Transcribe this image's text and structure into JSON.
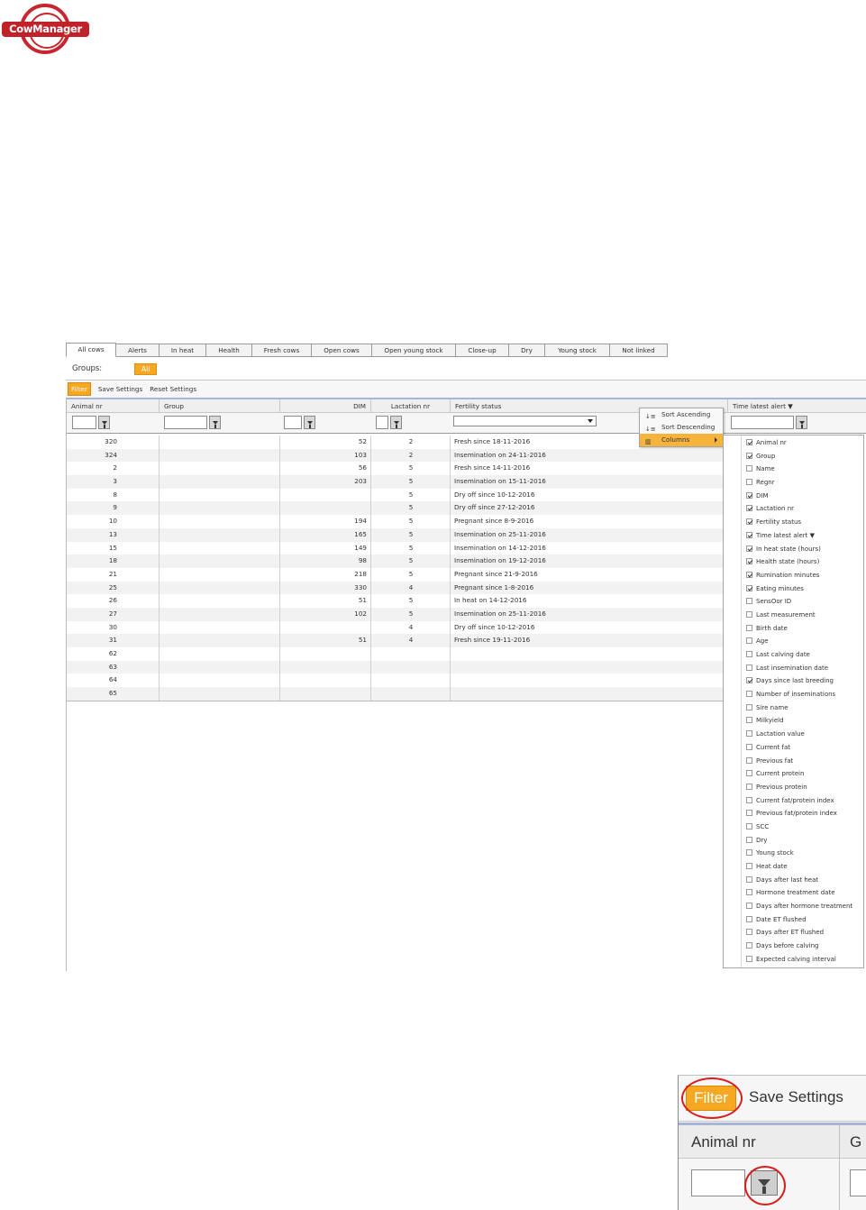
{
  "logo": {
    "text": "CowManager"
  },
  "tabs": [
    {
      "label": "All cows",
      "active": true
    },
    {
      "label": "Alerts"
    },
    {
      "label": "In heat"
    },
    {
      "label": "Health"
    },
    {
      "label": "Fresh cows"
    },
    {
      "label": "Open cows"
    },
    {
      "label": "Open young stock"
    },
    {
      "label": "Close-up"
    },
    {
      "label": "Dry"
    },
    {
      "label": "Young stock"
    },
    {
      "label": "Not linked"
    }
  ],
  "groups": {
    "label": "Groups:",
    "all_button": "All"
  },
  "toolbar": {
    "filter": "Filter",
    "save": "Save Settings",
    "reset": "Reset Settings"
  },
  "columns": {
    "animal_nr": "Animal nr",
    "group": "Group",
    "dim": "DIM",
    "lactation_nr": "Lactation nr",
    "fertility_status": "Fertility status",
    "time_latest_alert": "Time latest alert ▼"
  },
  "rows": [
    {
      "animal": "320",
      "dim": "52",
      "lact": "2",
      "fert": "Fresh since 18-11-2016"
    },
    {
      "animal": "324",
      "dim": "103",
      "lact": "2",
      "fert": "Insemination on 24-11-2016"
    },
    {
      "animal": "2",
      "dim": "56",
      "lact": "5",
      "fert": "Fresh since 14-11-2016"
    },
    {
      "animal": "3",
      "dim": "203",
      "lact": "5",
      "fert": "Insemination on 15-11-2016"
    },
    {
      "animal": "8",
      "dim": "",
      "lact": "5",
      "fert": "Dry off since 10-12-2016"
    },
    {
      "animal": "9",
      "dim": "",
      "lact": "5",
      "fert": "Dry off since 27-12-2016"
    },
    {
      "animal": "10",
      "dim": "194",
      "lact": "5",
      "fert": "Pregnant since 8-9-2016"
    },
    {
      "animal": "13",
      "dim": "165",
      "lact": "5",
      "fert": "Insemination on 25-11-2016"
    },
    {
      "animal": "15",
      "dim": "149",
      "lact": "5",
      "fert": "Insemination on 14-12-2016"
    },
    {
      "animal": "18",
      "dim": "98",
      "lact": "5",
      "fert": "Insemination on 19-12-2016"
    },
    {
      "animal": "21",
      "dim": "218",
      "lact": "5",
      "fert": "Pregnant since 21-9-2016"
    },
    {
      "animal": "25",
      "dim": "330",
      "lact": "4",
      "fert": "Pregnant since 1-8-2016"
    },
    {
      "animal": "26",
      "dim": "51",
      "lact": "5",
      "fert": "In heat on 14-12-2016"
    },
    {
      "animal": "27",
      "dim": "102",
      "lact": "5",
      "fert": "Insemination on 25-11-2016"
    },
    {
      "animal": "30",
      "dim": "",
      "lact": "4",
      "fert": "Dry off since 10-12-2016"
    },
    {
      "animal": "31",
      "dim": "51",
      "lact": "4",
      "fert": "Fresh since 19-11-2016"
    },
    {
      "animal": "62",
      "dim": "",
      "lact": "",
      "fert": ""
    },
    {
      "animal": "63",
      "dim": "",
      "lact": "",
      "fert": ""
    },
    {
      "animal": "64",
      "dim": "",
      "lact": "",
      "fert": ""
    },
    {
      "animal": "65",
      "dim": "",
      "lact": "",
      "fert": ""
    }
  ],
  "context_menu": {
    "sort_asc": "Sort Ascending",
    "sort_desc": "Sort Descending",
    "columns": "Columns"
  },
  "column_chooser": [
    {
      "label": "Animal nr",
      "checked": true
    },
    {
      "label": "Group",
      "checked": true
    },
    {
      "label": "Name",
      "checked": false
    },
    {
      "label": "Regnr",
      "checked": false
    },
    {
      "label": "DIM",
      "checked": true
    },
    {
      "label": "Lactation nr",
      "checked": true
    },
    {
      "label": "Fertility status",
      "checked": true
    },
    {
      "label": "Time latest alert ▼",
      "checked": true
    },
    {
      "label": "In heat state (hours)",
      "checked": true
    },
    {
      "label": "Health state (hours)",
      "checked": true
    },
    {
      "label": "Rumination minutes",
      "checked": true
    },
    {
      "label": "Eating minutes",
      "checked": true
    },
    {
      "label": "SensOor ID",
      "checked": false
    },
    {
      "label": "Last measurement",
      "checked": false
    },
    {
      "label": "Birth date",
      "checked": false
    },
    {
      "label": "Age",
      "checked": false
    },
    {
      "label": "Last calving date",
      "checked": false
    },
    {
      "label": "Last insemination date",
      "checked": false
    },
    {
      "label": "Days since last breeding",
      "checked": true
    },
    {
      "label": "Number of inseminations",
      "checked": false
    },
    {
      "label": "Sire name",
      "checked": false
    },
    {
      "label": "Milkyield",
      "checked": false
    },
    {
      "label": "Lactation value",
      "checked": false
    },
    {
      "label": "Current fat",
      "checked": false
    },
    {
      "label": "Previous fat",
      "checked": false
    },
    {
      "label": "Current protein",
      "checked": false
    },
    {
      "label": "Previous protein",
      "checked": false
    },
    {
      "label": "Current fat/protein index",
      "checked": false
    },
    {
      "label": "Previous fat/protein index",
      "checked": false
    },
    {
      "label": "SCC",
      "checked": false
    },
    {
      "label": "Dry",
      "checked": false
    },
    {
      "label": "Young stock",
      "checked": false
    },
    {
      "label": "Heat date",
      "checked": false
    },
    {
      "label": "Days after last heat",
      "checked": false
    },
    {
      "label": "Hormone treatment date",
      "checked": false
    },
    {
      "label": "Days after hormone treatment",
      "checked": false
    },
    {
      "label": "Date ET flushed",
      "checked": false
    },
    {
      "label": "Days after ET flushed",
      "checked": false
    },
    {
      "label": "Days before calving",
      "checked": false
    },
    {
      "label": "Expected calving interval",
      "checked": false
    }
  ],
  "zoom": {
    "filter": "Filter",
    "save": "Save Settings",
    "column": "Animal nr",
    "next_column_initial": "G"
  },
  "colors": {
    "accent": "#f7a823",
    "brand": "#c0222a",
    "highlight_ring": "#d61f1f"
  }
}
